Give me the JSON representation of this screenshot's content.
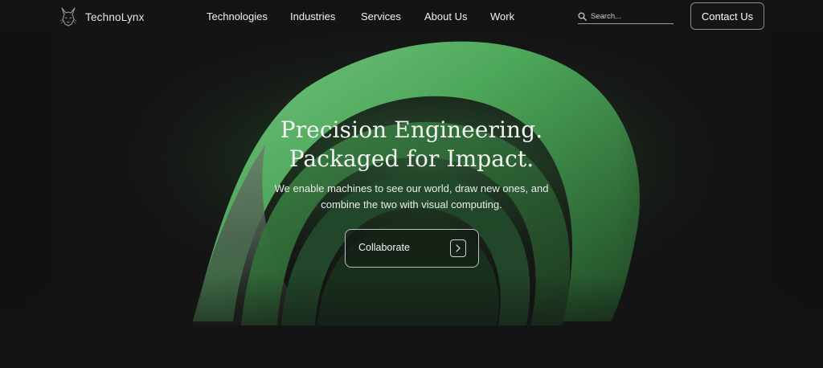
{
  "header": {
    "logo_text": "TechnoLynx",
    "logo_icon": "lynx-head-icon",
    "nav": [
      {
        "label": "Technologies"
      },
      {
        "label": "Industries"
      },
      {
        "label": "Services"
      },
      {
        "label": "About Us"
      },
      {
        "label": "Work"
      }
    ],
    "search": {
      "placeholder": "Search...",
      "icon": "search-icon"
    },
    "contact_label": "Contact Us"
  },
  "hero": {
    "headline_line1": "Precision Engineering.",
    "headline_line2": "Packaged for Impact.",
    "subtitle_line1": "We enable machines to see our world, draw new ones, and",
    "subtitle_line2": "combine the two with visual computing.",
    "cta_label": "Collaborate",
    "cta_icon": "chevron-right-icon"
  },
  "colors": {
    "background": "#141414",
    "accent_green": "#5fbf6a",
    "text": "#f2f2f2"
  }
}
